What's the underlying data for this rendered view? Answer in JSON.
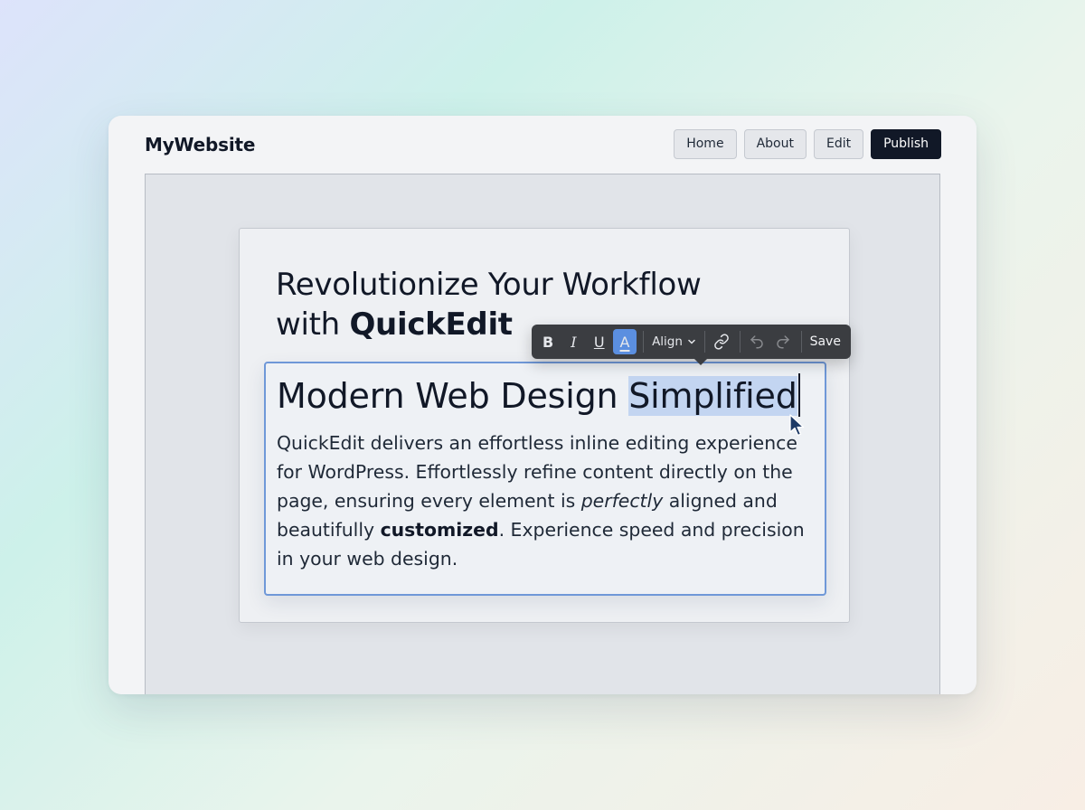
{
  "header": {
    "brand": "MyWebsite",
    "nav": [
      "Home",
      "About",
      "Edit"
    ],
    "publish_label": "Publish"
  },
  "hero": {
    "line1": "Revolutionize Your Workflow",
    "line2_prefix": "with ",
    "line2_bold": "QuickEdit"
  },
  "editor": {
    "heading_before": "Modern Web Design ",
    "heading_selected": "Simplified",
    "body": [
      {
        "t": "QuickEdit delivers an effortless inline editing experience for WordPress. Effortlessly refine content directly on the page, ensuring every element is "
      },
      {
        "t": "perfectly",
        "style": "italic"
      },
      {
        "t": " aligned and beautifully "
      },
      {
        "t": "customized",
        "style": "bold"
      },
      {
        "t": ". Experience speed and precision in your web design."
      }
    ]
  },
  "toolbar": {
    "bold": "B",
    "italic": "I",
    "underline": "U",
    "text_color": "A",
    "align_label": "Align",
    "save_label": "Save",
    "active_color": "#5b8fe0"
  },
  "icons": [
    "chevron-down-icon",
    "link-icon",
    "undo-icon",
    "redo-icon",
    "mouse-pointer-icon"
  ]
}
